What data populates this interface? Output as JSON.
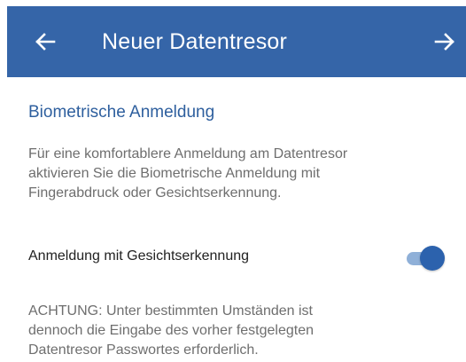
{
  "appbar": {
    "title": "Neuer Datentresor",
    "back_icon": "arrow-left-icon",
    "forward_icon": "arrow-right-icon",
    "background_color": "#3565a8"
  },
  "section": {
    "title": "Biometrische Anmeldung",
    "description_lines": [
      "Für eine komfortablere Anmeldung am Datentresor",
      "aktivieren Sie die Biometrische Anmeldung mit",
      "Fingerabdruck oder Gesichtserkennung."
    ]
  },
  "setting": {
    "label": "Anmeldung mit Gesichtserkennung",
    "enabled": true,
    "accent_color": "#2c62ad"
  },
  "warning": {
    "lines": [
      "ACHTUNG: Unter bestimmten Umständen ist",
      "dennoch die Eingabe des vorher festgelegten",
      "Datentresor Passwortes erforderlich."
    ]
  }
}
